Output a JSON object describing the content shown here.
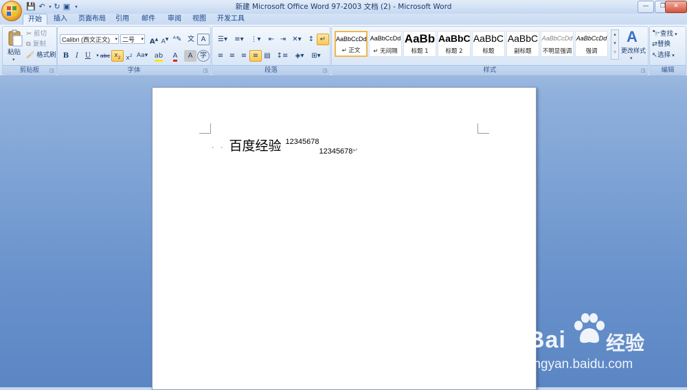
{
  "window": {
    "title": "新建 Microsoft Office Word 97-2003 文档 (2) - Microsoft Word",
    "minimize_label": "—",
    "restore_label": "❐",
    "close_label": "✕"
  },
  "quick_access": {
    "save_icon": "save-icon",
    "undo_icon": "undo-icon",
    "redo_icon": "redo-icon"
  },
  "tabs": [
    {
      "label": "开始",
      "active": true
    },
    {
      "label": "插入"
    },
    {
      "label": "页面布局"
    },
    {
      "label": "引用"
    },
    {
      "label": "邮件"
    },
    {
      "label": "审阅"
    },
    {
      "label": "视图"
    },
    {
      "label": "开发工具"
    }
  ],
  "clipboard": {
    "paste_label": "粘贴",
    "cut_label": "剪切",
    "copy_label": "复制",
    "format_painter_label": "格式刷",
    "group_label": "剪贴板"
  },
  "font": {
    "font_name": "Calibri (西文正文)",
    "font_size": "二号",
    "group_label": "字体"
  },
  "paragraph": {
    "group_label": "段落"
  },
  "styles": {
    "items": [
      {
        "sample": "AaBbCcDd",
        "name": "↵ 正文",
        "selected": true
      },
      {
        "sample": "AaBbCcDd",
        "name": "↵ 无间隔"
      },
      {
        "sample": "AaBb",
        "name": "标题 1"
      },
      {
        "sample": "AaBbC",
        "name": "标题 2"
      },
      {
        "sample": "AaBbC",
        "name": "标题"
      },
      {
        "sample": "AaBbC",
        "name": "副标题"
      },
      {
        "sample": "AaBbCcDd",
        "name": "不明显强调"
      },
      {
        "sample": "AaBbCcDd",
        "name": "强调"
      }
    ],
    "change_styles_label": "更改样式",
    "group_label": "样式"
  },
  "editing": {
    "find_label": "查找",
    "replace_label": "替换",
    "select_label": "选择",
    "group_label": "编辑"
  },
  "document": {
    "leading_marks": "· ·",
    "main_text": "百度经验",
    "superscript_text": "12345678",
    "subscript_text": "12345678",
    "paragraph_mark": "↵"
  },
  "watermark": {
    "brand": "Bai",
    "brand_suffix": "经验",
    "url": "jingyan.baidu.com"
  }
}
